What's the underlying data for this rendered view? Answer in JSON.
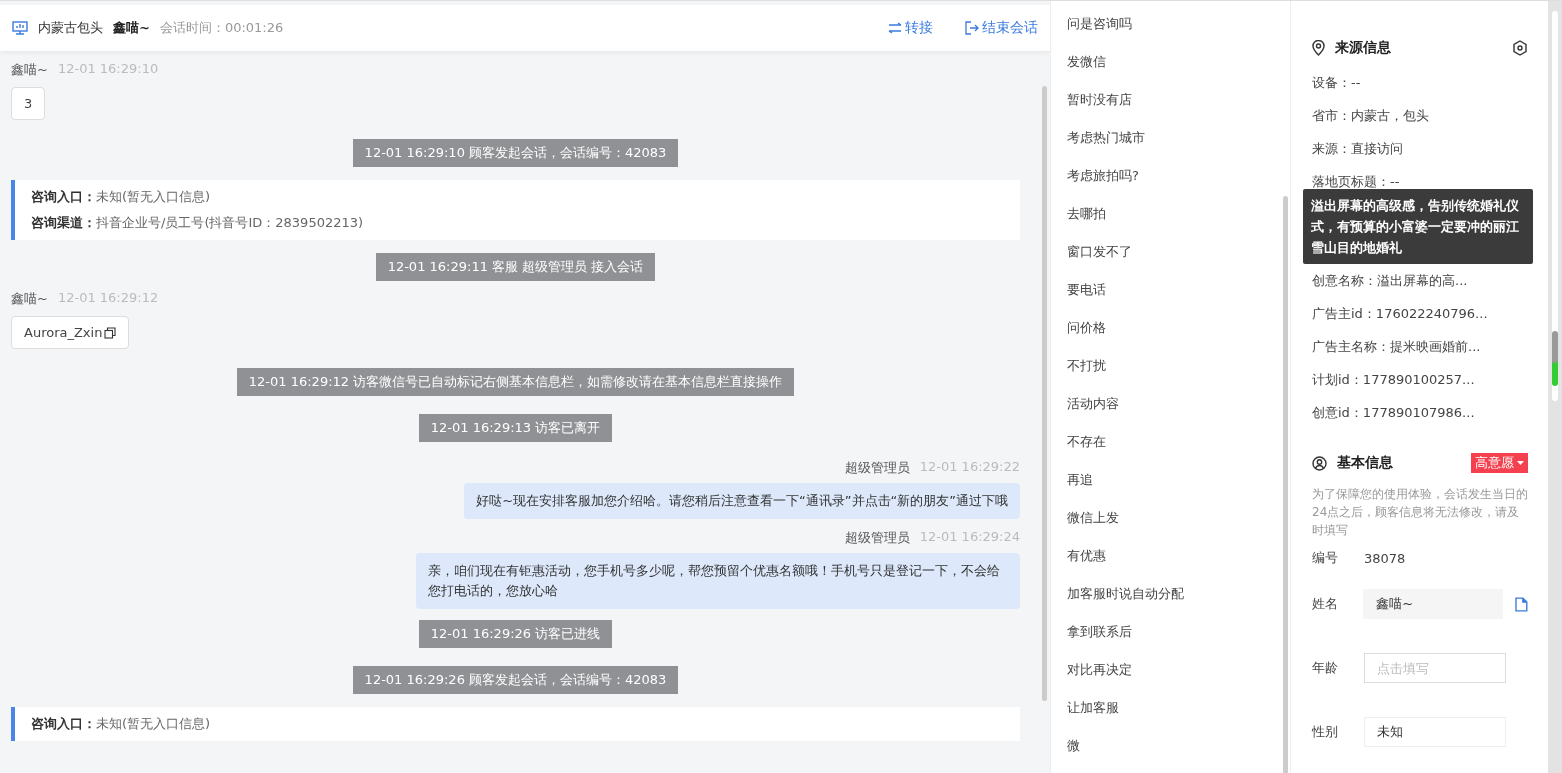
{
  "header": {
    "title": "内蒙古包头",
    "visitor": "鑫喵~",
    "duration": "会话时间：00:01:26",
    "actions": [
      {
        "kind": "transfer",
        "label": "转接"
      },
      {
        "kind": "end",
        "label": "结束会话"
      }
    ]
  },
  "messages": [
    {
      "kind": "visitor",
      "sender": "鑫喵~",
      "time": "12-01 16:29:10",
      "text": "3",
      "copyable": false
    },
    {
      "kind": "system",
      "text": "12-01 16:29:10 顾客发起会话，会话编号：42083"
    },
    {
      "kind": "info",
      "lines": [
        {
          "label": "咨询入口：",
          "value": "未知(暂无入口信息)"
        },
        {
          "label": "咨询渠道：",
          "value": "抖音企业号/员工号(抖音号ID：2839502213)"
        }
      ]
    },
    {
      "kind": "system",
      "text": "12-01 16:29:11 客服 超级管理员 接入会话"
    },
    {
      "kind": "visitor",
      "sender": "鑫喵~",
      "time": "12-01 16:29:12",
      "text": "Aurora_Zxin",
      "copyable": true
    },
    {
      "kind": "system",
      "text": "12-01 16:29:12 访客微信号已自动标记右侧基本信息栏，如需修改请在基本信息栏直接操作"
    },
    {
      "kind": "system",
      "text": "12-01 16:29:13 访客已离开"
    },
    {
      "kind": "agent",
      "sender": "超级管理员",
      "time": "12-01 16:29:22",
      "text": "好哒~现在安排客服加您介绍哈。请您稍后注意查看一下“通讯录”并点击“新的朋友”通过下哦"
    },
    {
      "kind": "agent",
      "sender": "超级管理员",
      "time": "12-01 16:29:24",
      "text": "亲，咱们现在有钜惠活动，您手机号多少呢，帮您预留个优惠名额哦！手机号只是登记一下，不会给您打电话的，您放心哈"
    },
    {
      "kind": "system",
      "text": "12-01 16:29:26 访客已进线"
    },
    {
      "kind": "system",
      "text": "12-01 16:29:26 顾客发起会话，会话编号：42083"
    },
    {
      "kind": "info",
      "lines": [
        {
          "label": "咨询入口：",
          "value": "未知(暂无入口信息)"
        }
      ]
    }
  ],
  "quick_replies": [
    "问是咨询吗",
    "发微信",
    "暂时没有店",
    "考虑热门城市",
    "考虑旅拍吗?",
    "去哪拍",
    "窗口发不了",
    "要电话",
    "问价格",
    "不打扰",
    "活动内容",
    "不存在",
    "再追",
    "微信上发",
    "有优惠",
    "加客服时说自动分配",
    "拿到联系后",
    "对比再决定",
    "让加客服",
    "微"
  ],
  "source_info": {
    "title": "来源信息",
    "items": [
      {
        "text": "设备：--"
      },
      {
        "text": "省市：内蒙古，包头"
      },
      {
        "text": "来源：直接访问"
      },
      {
        "text": "落地页标题：--"
      },
      {
        "text": "创意名称：溢出屏幕的高..."
      },
      {
        "text": "广告主id：176022240796..."
      },
      {
        "text": "广告主名称：提米映画婚前..."
      },
      {
        "text": "计划id：177890100257..."
      },
      {
        "text": "创意id：177890107986..."
      }
    ],
    "tooltip": "溢出屏幕的高级感，告别传统婚礼仪式，有预算的小富婆一定要冲的丽江雪山目的地婚礼"
  },
  "basic_info": {
    "title": "基本信息",
    "intent_tag": "高意愿",
    "notice": "为了保障您的使用体验，会话发生当日的24点之后，顾客信息将无法修改，请及时填写",
    "fields": [
      {
        "kind": "static",
        "label": "编号",
        "value": "38078"
      },
      {
        "kind": "filled",
        "label": "姓名",
        "value": "鑫喵~"
      },
      {
        "kind": "input",
        "label": "年龄",
        "placeholder": "点击填写"
      },
      {
        "kind": "input",
        "label": "性别",
        "value": "未知"
      }
    ]
  }
}
